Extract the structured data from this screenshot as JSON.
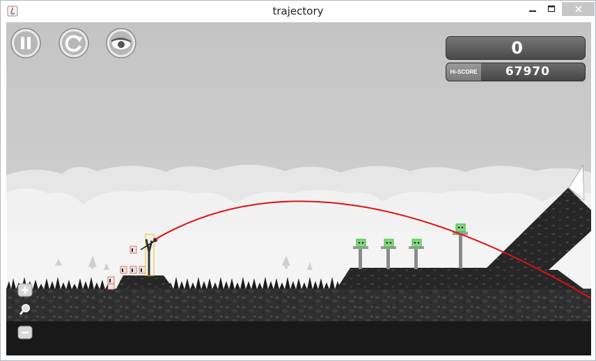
{
  "window": {
    "title": "trajectory"
  },
  "icons": {
    "app": "java-app-icon",
    "minimize": "minimize-icon",
    "maximize": "maximize-icon",
    "close": "close-icon",
    "pause": "pause-icon",
    "restart": "restart-icon",
    "view": "eye-icon",
    "zoom_in": "plus-icon",
    "zoom": "magnifier-icon",
    "zoom_out": "minus-icon"
  },
  "hud": {
    "score": "0",
    "hiscore_label": "Hi-SCORE",
    "hiscore_value": "67970"
  },
  "colors": {
    "trajectory": "#dd1111",
    "sky": "#c8c8c8",
    "ground": "#2e2e2e",
    "highlight_box": "#e8c840",
    "pig_box": "#22cc22"
  }
}
